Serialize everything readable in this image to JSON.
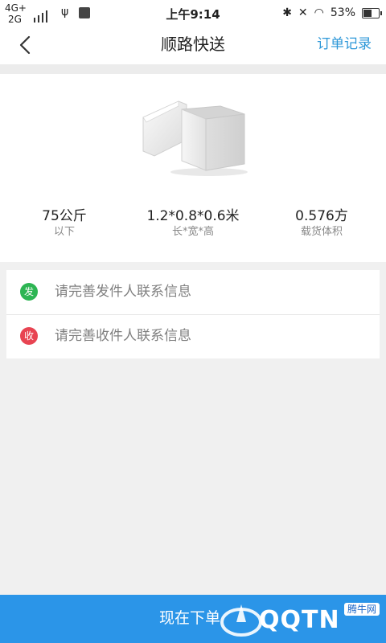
{
  "status_bar": {
    "network_1": "4G+",
    "network_2": "2G",
    "time": "上午9:14",
    "battery": "53%",
    "battery_level": 0.53
  },
  "nav": {
    "title": "顺路快送",
    "right_label": "订单记录"
  },
  "box_specs": [
    {
      "value": "75公斤",
      "label": "以下"
    },
    {
      "value": "1.2*0.8*0.6米",
      "label": "长*宽*高"
    },
    {
      "value": "0.576方",
      "label": "载货体积"
    }
  ],
  "contacts": {
    "sender": {
      "badge": "发",
      "text": "请完善发件人联系信息"
    },
    "receiver": {
      "badge": "收",
      "text": "请完善收件人联系信息"
    }
  },
  "bottom": {
    "button_label": "现在下单"
  },
  "watermark": {
    "text": "QQTN",
    "badge": "腾牛网"
  },
  "colors": {
    "accent": "#2c97d8",
    "bottom_button": "#2b95e8",
    "send_badge": "#2db553",
    "receive_badge": "#e84452"
  }
}
